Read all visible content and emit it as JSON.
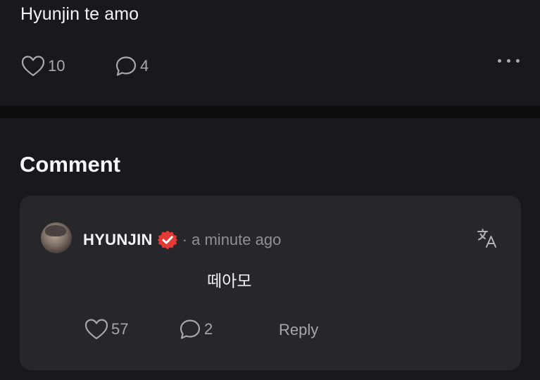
{
  "post": {
    "text": "Hyunjin te amo",
    "likes": "10",
    "comments": "4"
  },
  "section": {
    "title": "Comment"
  },
  "comment": {
    "username": "HYUNJIN",
    "time": "· a minute ago",
    "text": "떼아모",
    "likes": "57",
    "replies": "2",
    "reply_label": "Reply"
  },
  "colors": {
    "background": "#19191d",
    "divider": "#0e0e10",
    "card": "#26262b",
    "verified_badge": "#e53935",
    "muted_text": "#a9a9b0"
  },
  "icons": {
    "like": "heart-icon",
    "comment": "speech-bubble-icon",
    "more": "more-dots-icon",
    "verified": "verified-badge-icon",
    "translate": "translate-icon"
  }
}
